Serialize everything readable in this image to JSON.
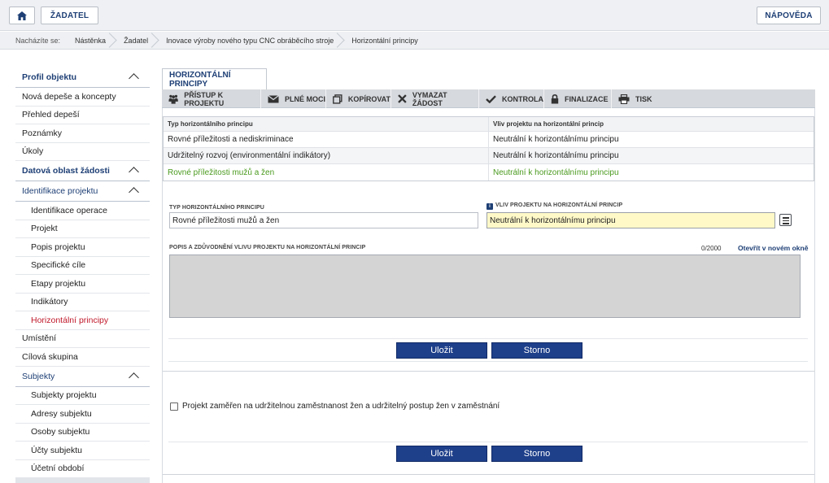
{
  "topbar": {
    "home_icon": "home-icon",
    "zadatel_label": "ŽADATEL",
    "napoveda_label": "NÁPOVĚDA"
  },
  "breadcrumb": {
    "lead": "Nacházíte se:",
    "items": [
      "Nástěnka",
      "Žadatel",
      "Inovace výroby nového typu CNC obráběcího stroje",
      "Horizontální principy"
    ]
  },
  "sidebar": {
    "items": [
      {
        "label": "Profil objektu"
      },
      {
        "label": "Nová depeše a koncepty"
      },
      {
        "label": "Přehled depeší"
      },
      {
        "label": "Poznámky"
      },
      {
        "label": "Úkoly"
      },
      {
        "label": "Datová oblast žádosti"
      },
      {
        "label": "Identifikace projektu"
      },
      {
        "label": "Identifikace operace"
      },
      {
        "label": "Projekt"
      },
      {
        "label": "Popis projektu"
      },
      {
        "label": "Specifické cíle"
      },
      {
        "label": "Etapy projektu"
      },
      {
        "label": "Indikátory"
      },
      {
        "label": "Horizontální principy"
      },
      {
        "label": "Umístění"
      },
      {
        "label": "Cílová skupina"
      },
      {
        "label": "Subjekty"
      },
      {
        "label": "Subjekty projektu"
      },
      {
        "label": "Adresy subjektu"
      },
      {
        "label": "Osoby subjektu"
      },
      {
        "label": "Účty subjektu"
      },
      {
        "label": "Účetní období"
      }
    ]
  },
  "main": {
    "tab_label": "HORIZONTÁLNÍ PRINCIPY",
    "toolbar": [
      {
        "label": "PŘÍSTUP K PROJEKTU",
        "icon": "people-icon"
      },
      {
        "label": "PLNÉ MOCI",
        "icon": "envelope-icon"
      },
      {
        "label": "KOPÍROVAT",
        "icon": "copy-icon"
      },
      {
        "label": "VYMAZAT ŽÁDOST",
        "icon": "x-icon"
      },
      {
        "label": "KONTROLA",
        "icon": "check-icon"
      },
      {
        "label": "FINALIZACE",
        "icon": "lock-icon"
      },
      {
        "label": "TISK",
        "icon": "printer-icon"
      }
    ],
    "grid": {
      "headers": [
        "Typ horizontálního principu",
        "Vliv projektu na horizontální princip"
      ],
      "rows": [
        [
          "Rovné příležitosti a nediskriminace",
          "Neutrální k horizontálnímu principu"
        ],
        [
          "Udržitelný rozvoj (environmentální indikátory)",
          "Neutrální k horizontálnímu principu"
        ],
        [
          "Rovné příležitosti mužů a žen",
          "Neutrální k horizontálnímu principu"
        ]
      ]
    },
    "form": {
      "typ_label": "TYP HORIZONTÁLNÍHO PRINCIPU",
      "typ_value": "Rovné příležitosti mužů a žen",
      "vliv_label": "VLIV PROJEKTU NA HORIZONTÁLNÍ PRINCIP",
      "vliv_value": "Neutrální k horizontálnímu principu",
      "popis_label": "POPIS A ZDŮVODNĚNÍ VLIVU PROJEKTU NA HORIZONTÁLNÍ PRINCIP",
      "counter": "0/2000",
      "open_link": "Otevřít v novém okně",
      "save_label": "Uložit",
      "cancel_label": "Storno"
    },
    "checkbox": {
      "label": "Projekt zaměřen na udržitelnou zaměstnanost žen a udržitelný postup žen v zaměstnání",
      "checked": false,
      "save_label": "Uložit",
      "cancel_label": "Storno"
    }
  },
  "colors": {
    "brand_blue": "#1e3f75",
    "button_blue": "#1e3f8a",
    "active_red": "#c0182a",
    "selected_green": "#4a9a1e",
    "required_yellow": "#fff9c8"
  }
}
